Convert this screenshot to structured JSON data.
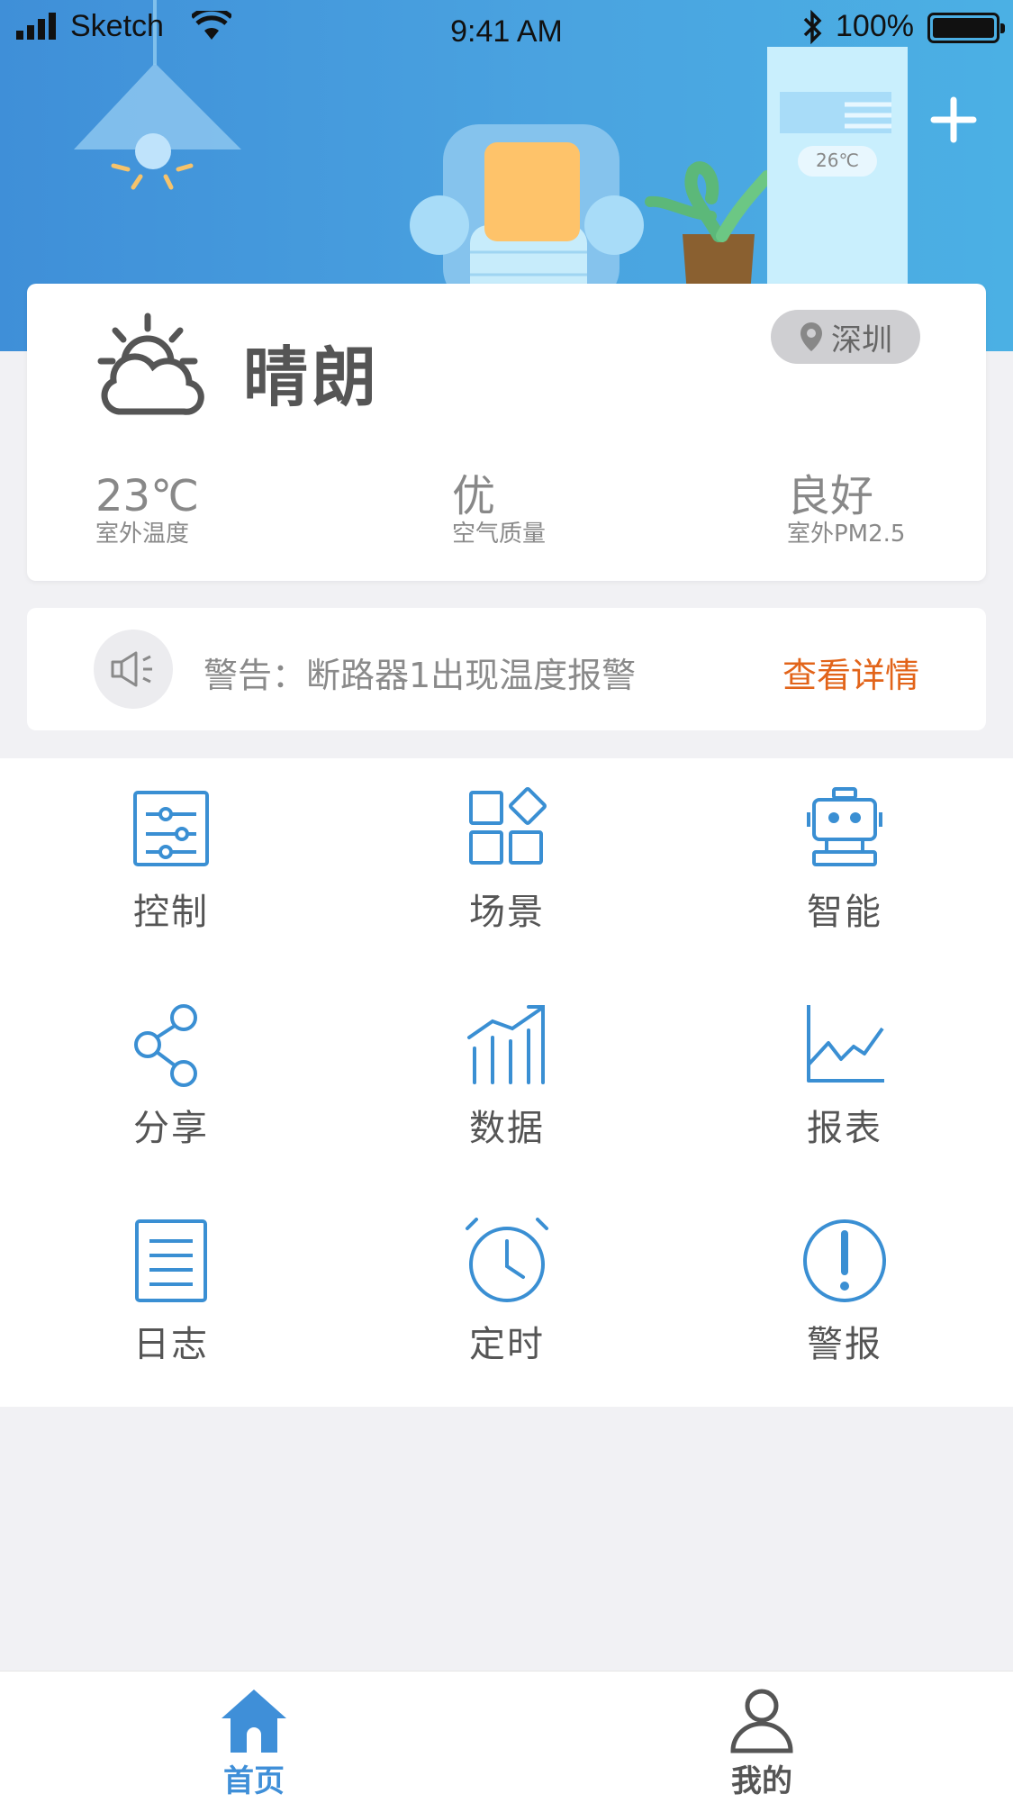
{
  "status_bar": {
    "carrier": "Sketch",
    "time": "9:41 AM",
    "battery": "100%"
  },
  "hero": {
    "ac_display": "26℃",
    "add_icon": "plus-icon"
  },
  "weather": {
    "condition": "晴朗",
    "icon": "partly-sunny-icon",
    "city": "深圳",
    "stats": [
      {
        "value": "23℃",
        "label": "室外温度"
      },
      {
        "value": "优",
        "label": "空气质量"
      },
      {
        "value": "良好",
        "label": "室外PM2.5"
      }
    ]
  },
  "alert": {
    "icon": "speaker-icon",
    "message": "警告：断路器1出现温度报警",
    "link": "查看详情"
  },
  "features": [
    {
      "label": "控制",
      "icon": "sliders-icon"
    },
    {
      "label": "场景",
      "icon": "scene-grid-icon"
    },
    {
      "label": "智能",
      "icon": "robot-icon"
    },
    {
      "label": "分享",
      "icon": "share-icon"
    },
    {
      "label": "数据",
      "icon": "bar-chart-icon"
    },
    {
      "label": "报表",
      "icon": "line-chart-icon"
    },
    {
      "label": "日志",
      "icon": "document-icon"
    },
    {
      "label": "定时",
      "icon": "alarm-clock-icon"
    },
    {
      "label": "警报",
      "icon": "exclamation-icon"
    }
  ],
  "tabs": [
    {
      "label": "首页",
      "icon": "home-icon",
      "active": true
    },
    {
      "label": "我的",
      "icon": "user-icon",
      "active": false
    }
  ],
  "colors": {
    "primary": "#3f8fd8",
    "link": "#e2641a",
    "icon_blue": "#3a8fd3"
  }
}
